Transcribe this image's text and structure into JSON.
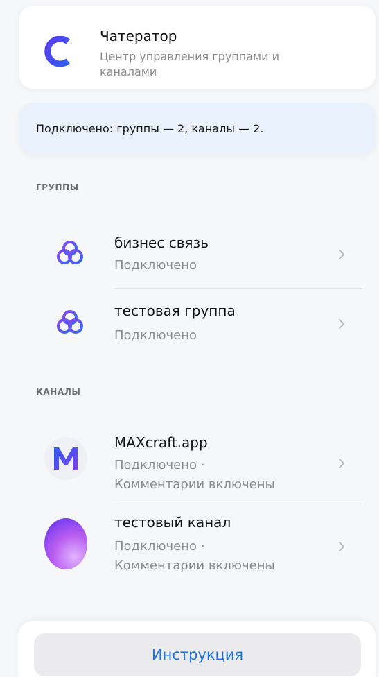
{
  "app": {
    "title": "Чатератор",
    "subtitle": "Центр управления группами и каналами",
    "logo_icon": "c-logo-icon",
    "brand_color": "#3a46e8"
  },
  "status": {
    "text": "Подключено: группы — 2, каналы — 2."
  },
  "groups": {
    "header": "ГРУППЫ",
    "items": [
      {
        "title": "бизнес связь",
        "subtitle": "Подключено",
        "icon": "linked-rings-icon"
      },
      {
        "title": "тестовая группа",
        "subtitle": "Подключено",
        "icon": "linked-rings-icon"
      }
    ]
  },
  "channels": {
    "header": "КАНАЛЫ",
    "items": [
      {
        "title": "MAXcraft.app",
        "subtitle_line1": "Подключено ·",
        "subtitle_line2": "Комментарии включены",
        "icon": "m-logo-avatar"
      },
      {
        "title": "тестовый канал",
        "subtitle_line1": "Подключено ·",
        "subtitle_line2": "Комментарии включены",
        "icon": "gradient-avatar"
      }
    ]
  },
  "footer": {
    "button_label": "Инструкция",
    "accent_color": "#1a73e8"
  }
}
